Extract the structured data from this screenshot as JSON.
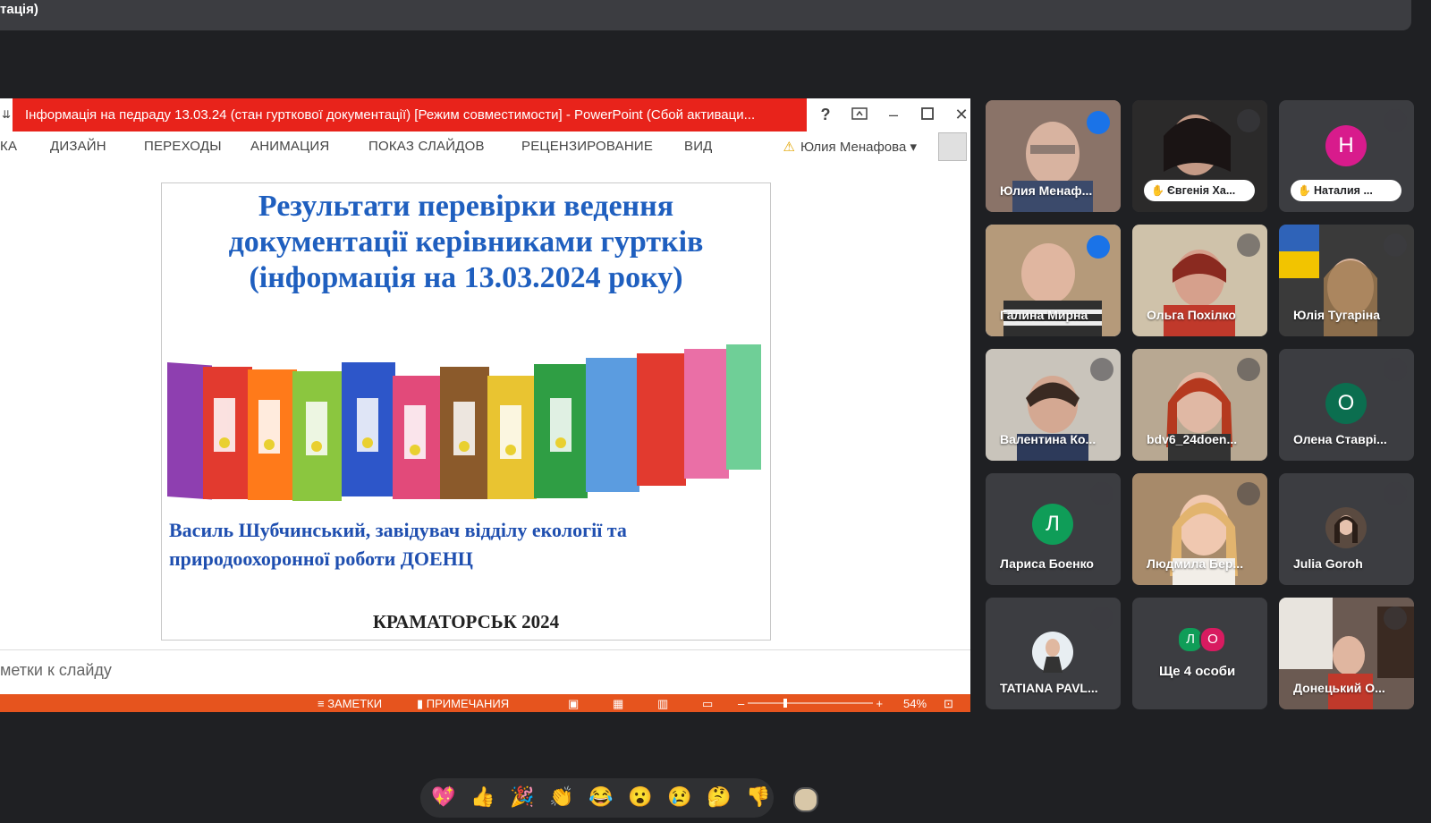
{
  "window": {
    "title_fragment": "тація)"
  },
  "powerpoint": {
    "title": "Інформація на педраду 13.03.24 (стан гурткової документації) [Режим совместимости] -  PowerPoint (Сбой активаци...",
    "help": "?",
    "ribbon_tabs": [
      "КА",
      "ДИЗАЙН",
      "ПЕРЕХОДЫ",
      "АНИМАЦИЯ",
      "ПОКАЗ СЛАЙДОВ",
      "РЕЦЕНЗИРОВАНИЕ",
      "ВИД"
    ],
    "user_name": "Юлия Менафова",
    "slide": {
      "title_lines": [
        "Результати перевірки ведення",
        "документації керівниками гуртків",
        "(інформація на 13.03.2024 року)"
      ],
      "subtitle_lines": [
        "Василь Шубчинський, завідувач відділу екології та",
        "природоохоронної роботи ДОЕНЦ"
      ],
      "footer": "КРАМАТОРСЬК 2024"
    },
    "notes_placeholder": "метки к слайду",
    "status": {
      "notes_label": "ЗАМЕТКИ",
      "comments_label": "ПРИМЕЧАНИЯ",
      "zoom": "54%"
    }
  },
  "participants": [
    {
      "name": "Юлия Менаф...",
      "kind": "photo",
      "speaking": true,
      "active": false
    },
    {
      "name": "Євгенія Ха...",
      "kind": "photo",
      "hand": true,
      "active": false
    },
    {
      "name": "Наталия ...",
      "kind": "letter",
      "letter": "Н",
      "color": "#d81b8c",
      "hand": true
    },
    {
      "name": "Галина Мирна",
      "kind": "photo",
      "speaking": true,
      "active": true
    },
    {
      "name": "Ольга Похілко",
      "kind": "photo"
    },
    {
      "name": "Юлія Тугаріна",
      "kind": "photo"
    },
    {
      "name": "Валентина Ко...",
      "kind": "photo"
    },
    {
      "name": "bdv6_24doen...",
      "kind": "photo"
    },
    {
      "name": "Олена Ставрі...",
      "kind": "letter",
      "letter": "О",
      "color": "#0b6e4f"
    },
    {
      "name": "Лариса Боенко",
      "kind": "letter",
      "letter": "Л",
      "color": "#0f9d58"
    },
    {
      "name": "Людмила Бер...",
      "kind": "photo"
    },
    {
      "name": "Julia Goroh",
      "kind": "avatar"
    },
    {
      "name": "TATIANA PAVL...",
      "kind": "avatar"
    },
    {
      "name": "Ще 4 особи",
      "kind": "more",
      "letters": [
        "Л",
        "О"
      ]
    },
    {
      "name": "Донецький О...",
      "kind": "photo"
    }
  ],
  "reactions": [
    "💖",
    "👍",
    "🎉",
    "👏",
    "😂",
    "😮",
    "😢",
    "🤔",
    "👎"
  ]
}
